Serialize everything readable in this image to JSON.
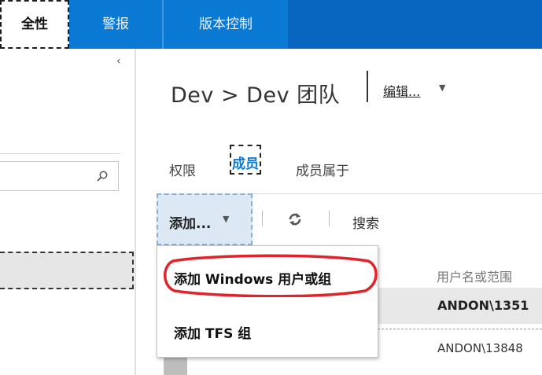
{
  "topbar": {
    "tabs": [
      {
        "label": "全性"
      },
      {
        "label": "警报"
      },
      {
        "label": "版本控制"
      }
    ]
  },
  "main": {
    "breadcrumb": "Dev > Dev 团队",
    "edit_label": "编辑...",
    "subtabs": [
      {
        "label": "权限"
      },
      {
        "label": "成员"
      },
      {
        "label": "成员属于"
      }
    ],
    "toolbar": {
      "add_label": "添加...",
      "search_label": "搜索"
    },
    "list": {
      "column_header": "用户名或范围",
      "rows": [
        {
          "name": "ANDON\\1351"
        },
        {
          "name": "ANDON\\13848"
        }
      ]
    }
  },
  "add_menu": {
    "items": [
      {
        "label": "添加 Windows 用户或组"
      },
      {
        "label": "添加 TFS 组"
      }
    ]
  },
  "colors": {
    "accent": "#0a79d4",
    "highlight_ring": "#e0242a"
  }
}
